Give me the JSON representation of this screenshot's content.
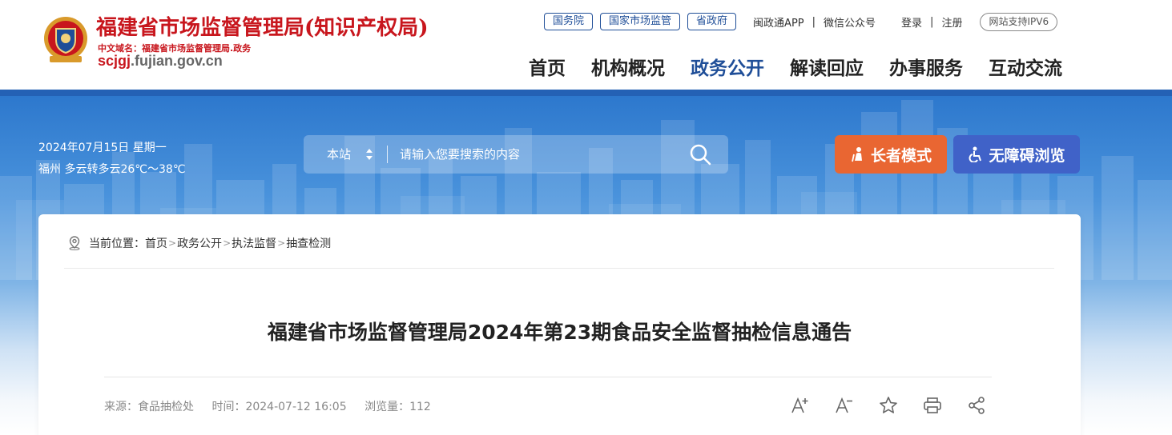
{
  "header": {
    "site_title": "福建省市场监督管理局(知识产权局)",
    "cn_domain": "中文域名：福建省市场监督管理局.政务",
    "en_domain_highlight": "scjgj",
    "en_domain_rest": ".fujian.gov.cn",
    "top_pills": [
      "国务院",
      "国家市场监管",
      "省政府"
    ],
    "top_links": [
      "闽政通APP",
      "微信公众号"
    ],
    "login": "登录",
    "register": "注册",
    "ipv6": "网站支持IPV6",
    "nav": [
      {
        "label": "首页",
        "active": false
      },
      {
        "label": "机构概况",
        "active": false
      },
      {
        "label": "政务公开",
        "active": true
      },
      {
        "label": "解读回应",
        "active": false
      },
      {
        "label": "办事服务",
        "active": false
      },
      {
        "label": "互动交流",
        "active": false
      }
    ],
    "accent_color": "#1f4e98",
    "brand_red": "#c8161d"
  },
  "banner": {
    "date": "2024年07月15日 星期一",
    "weather": "福州 多云转多云26℃～38℃",
    "search": {
      "scope": "本站",
      "placeholder": "请输入您要搜索的内容"
    },
    "elder_mode": "长者模式",
    "accessibility": "无障碍浏览",
    "elder_color": "#e96632",
    "access_color": "#4062c8"
  },
  "article": {
    "breadcrumb_prefix": "当前位置：",
    "breadcrumb": [
      "首页",
      "政务公开",
      "执法监督",
      "抽查检测"
    ],
    "title": "福建省市场监督管理局2024年第23期食品安全监督抽检信息通告",
    "source": "来源：食品抽检处",
    "time": "时间：2024-07-12 16:05",
    "views": "浏览量：112",
    "tools": [
      "font-increase-icon",
      "font-decrease-icon",
      "star-icon",
      "print-icon",
      "share-icon"
    ]
  }
}
